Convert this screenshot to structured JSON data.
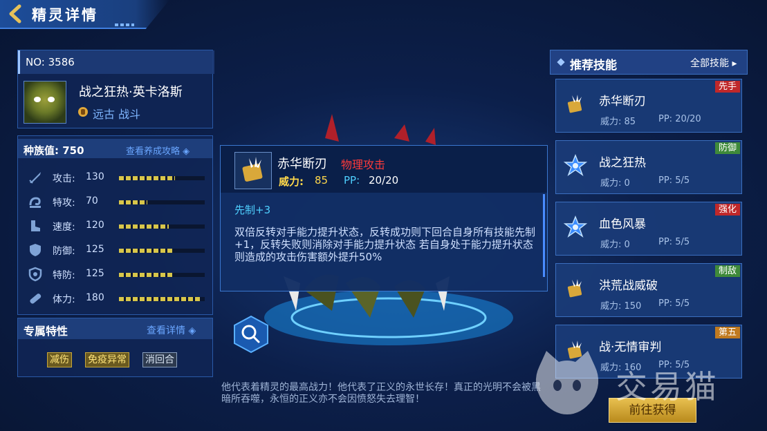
{
  "header": {
    "title": "精灵详情"
  },
  "spirit": {
    "no_label": "NO:",
    "no_value": "3586",
    "name": "战之狂热·英卡洛斯",
    "type_text": "远古 战斗"
  },
  "stats": {
    "race_label": "种族值:",
    "race_value": "750",
    "guide_link": "查看养成攻略",
    "rows": [
      {
        "label": "攻击:",
        "value": "130",
        "fraction": 0.65
      },
      {
        "label": "特攻:",
        "value": "70",
        "fraction": 0.33
      },
      {
        "label": "速度:",
        "value": "120",
        "fraction": 0.58
      },
      {
        "label": "防御:",
        "value": "125",
        "fraction": 0.62
      },
      {
        "label": "特防:",
        "value": "125",
        "fraction": 0.62
      },
      {
        "label": "体力:",
        "value": "180",
        "fraction": 0.95
      }
    ]
  },
  "traits": {
    "title": "专属特性",
    "link": "查看详情",
    "badges": [
      "减伤",
      "免疫异常",
      "消回合"
    ]
  },
  "popup": {
    "name": "赤华断刃",
    "category": "物理攻击",
    "power_label": "威力:",
    "power_value": "85",
    "pp_label": "PP:",
    "pp_value": "20/20",
    "priority": "先制+3",
    "description": "双倍反转对手能力提升状态，反转成功则下回合自身所有技能先制+1，反转失败则消除对手能力提升状态 若自身处于能力提升状态则造成的攻击伤害额外提升50%"
  },
  "skills": {
    "title": "推荐技能",
    "all_link": "全部技能",
    "items": [
      {
        "name": "赤华断刃",
        "power": "威力: 85",
        "pp": "PP:  20/20",
        "tag": "先手",
        "tag_color": "#c0282a",
        "icon": "gold-blade-icon"
      },
      {
        "name": "战之狂热",
        "power": "威力: 0",
        "pp": "PP:  5/5",
        "tag": "防御",
        "tag_color": "#3f8a3a",
        "icon": "blue-star-icon"
      },
      {
        "name": "血色风暴",
        "power": "威力: 0",
        "pp": "PP:  5/5",
        "tag": "强化",
        "tag_color": "#c0282a",
        "icon": "blue-star-icon"
      },
      {
        "name": "洪荒战威破",
        "power": "威力: 150",
        "pp": "PP:  5/5",
        "tag": "制敌",
        "tag_color": "#3f8a3a",
        "icon": "gold-blade-icon"
      },
      {
        "name": "战·无情审判",
        "power": "威力: 160",
        "pp": "PP:  5/5",
        "tag": "第五",
        "tag_color": "#c07a20",
        "icon": "gold-blade-icon"
      }
    ]
  },
  "obtain_button": "前往获得",
  "quote": "他代表着精灵的最高战力！他代表了正义的永世长存！真正的光明不会被黑暗所吞噬，永恒的正义亦不会因愤怒失去理智！",
  "watermark": "交易猫"
}
